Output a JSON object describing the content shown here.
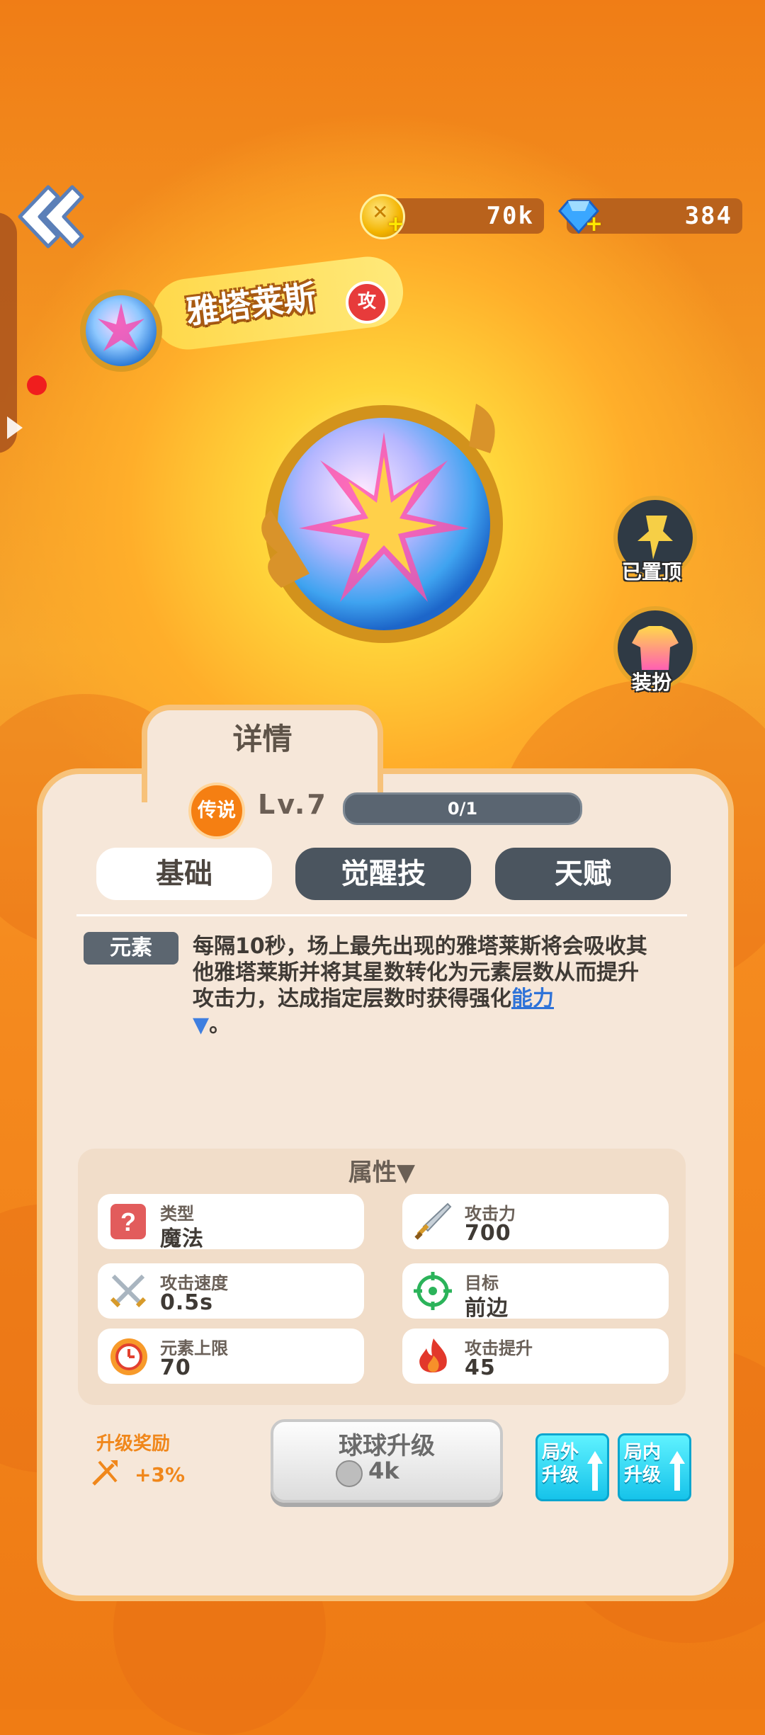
{
  "top_bar": {
    "coins": "70k",
    "gems": "384"
  },
  "hero": {
    "name": "雅塔莱斯",
    "role_badge": "攻"
  },
  "side_buttons": {
    "pin_label": "已置顶",
    "skin_label": "装扮"
  },
  "panel": {
    "tab_label": "详情",
    "rarity": "传说",
    "level": "Lv.7",
    "progress_text": "0/1",
    "progress_fraction": 0,
    "tabs": [
      "基础",
      "觉醒技",
      "天赋"
    ],
    "element_tag": "元素",
    "description_main": "每隔10秒，场上最先出现的雅塔莱斯将会吸收其他雅塔莱斯并将其星数转化为元素层数从而提升攻击力，达成指定层数时获得强化",
    "description_link": "能力",
    "description_end": "。",
    "attributes_title": "属性▼",
    "attributes": [
      {
        "label": "类型",
        "value": "魔法"
      },
      {
        "label": "攻击力",
        "value": "700"
      },
      {
        "label": "攻击速度",
        "value": "0.5s"
      },
      {
        "label": "目标",
        "value": "前边"
      },
      {
        "label": "元素上限",
        "value": "70"
      },
      {
        "label": "攻击提升",
        "value": "45"
      }
    ],
    "reward_label": "升级奖励",
    "reward_value": "+3%",
    "upgrade_label": "球球升级",
    "upgrade_cost": "4k",
    "outside_upgrade": "局外升级",
    "inside_upgrade": "局内升级"
  },
  "colors": {
    "background": "#f07c14",
    "panel": "#f6e7d9",
    "panel_border": "#f7c27a",
    "tab_inactive": "#4b555f",
    "link": "#2f73d8",
    "mini_button": "#16c3ea"
  }
}
